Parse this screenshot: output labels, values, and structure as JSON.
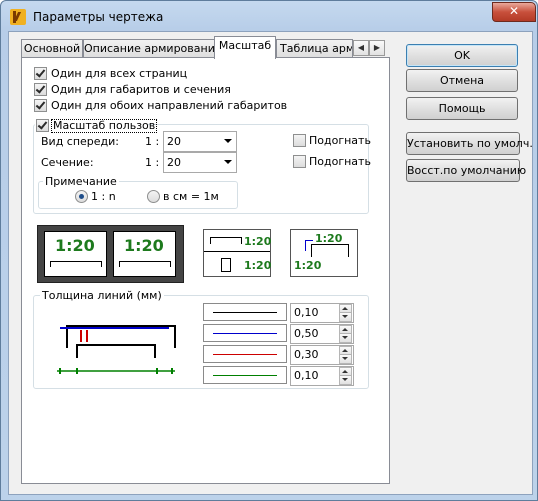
{
  "window": {
    "title": "Параметры чертежа",
    "close_symbol": "✕"
  },
  "tabs": [
    {
      "label": "Основной"
    },
    {
      "label": "Описание армирования"
    },
    {
      "label": "Масштаб"
    },
    {
      "label": "Таблица арма"
    }
  ],
  "tab_scroll": {
    "left": "◀",
    "right": "▶"
  },
  "checks": {
    "one_for_all_pages": {
      "label": "Один для всех страниц",
      "checked": true
    },
    "one_for_dims_sections": {
      "label": "Один для габаритов и сечения",
      "checked": true
    },
    "one_for_both_directions": {
      "label": "Один для обоих направлений габаритов",
      "checked": true
    },
    "user_scale": {
      "label": "Масштаб пользов",
      "checked": true
    }
  },
  "scale": {
    "front_view_label": "Вид спереди:",
    "front_prefix": "1 :",
    "front_value": "20",
    "front_fit_label": "Подогнать",
    "section_label": "Сечение:",
    "section_prefix": "1 :",
    "section_value": "20",
    "section_fit_label": "Подогнать"
  },
  "note": {
    "legend": "Примечание",
    "option_1n": "1 : n",
    "option_cm": "в см = 1м",
    "selected": "1 : n"
  },
  "previews": {
    "big_left": "1:20",
    "big_right": "1:20",
    "mid_top": "1:20",
    "mid_bottom": "1:20",
    "right_top": "1:20",
    "right_bottom": "1:20"
  },
  "line_thickness": {
    "legend": "Толщина линий (мм)",
    "rows": [
      {
        "value": "0,10",
        "color": "#000000"
      },
      {
        "value": "0,50",
        "color": "#0000cc"
      },
      {
        "value": "0,30",
        "color": "#cc0000"
      },
      {
        "value": "0,10",
        "color": "#008000"
      }
    ]
  },
  "buttons": {
    "ok": "OK",
    "cancel": "Отмена",
    "help": "Помощь",
    "set_default": "Установить по умолч.",
    "restore_default": "Восст.по умолчанию"
  }
}
